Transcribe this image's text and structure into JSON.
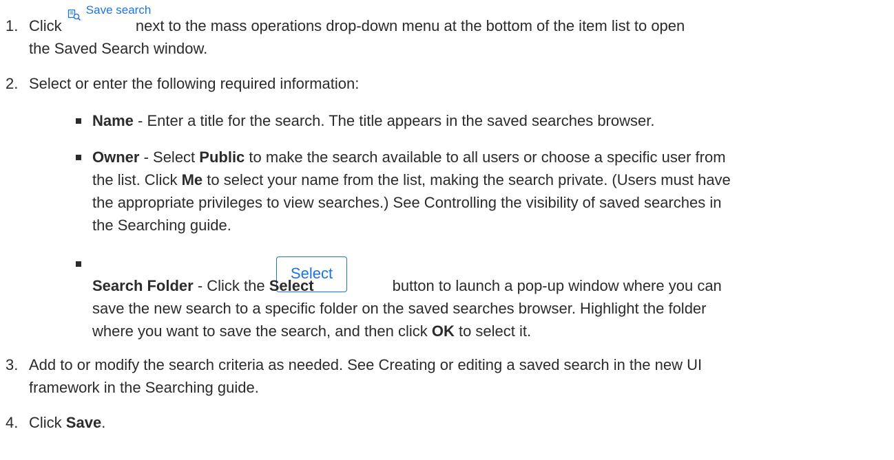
{
  "steps": [
    {
      "number": "1.",
      "pre": "Click",
      "button_label": "Save search",
      "button_icon": "save-search-icon",
      "post": "next to the mass operations drop-down menu at the bottom of the item list to open",
      "line2": "the Saved Search window."
    },
    {
      "number": "2.",
      "text": "Select or enter the following required information:"
    },
    {
      "number": "3.",
      "line1": "Add to or modify the search criteria as needed. See Creating or editing a saved search in the new UI",
      "line2": "framework in the Searching guide."
    },
    {
      "number": "4.",
      "pre": "Click",
      "bold": "Save",
      "post": "."
    }
  ],
  "bullets": {
    "name": {
      "term": "Name",
      "text": " - Enter a title for the search. The title appears in the saved searches browser."
    },
    "owner": {
      "term": "Owner",
      "t1": " - Select ",
      "b1": "Public",
      "t2": " to make the search available to all users or choose a specific user from",
      "t3": "the list. Click ",
      "b2": "Me",
      "t4": " to select your name from the list, making the search private. (Users must have",
      "line3": "the appropriate privileges to view searches.) See Controlling the visibility of saved searches in",
      "line4": "the Searching guide."
    },
    "folder": {
      "term": "Search Folder",
      "t1": " - Click the ",
      "b1": "Select",
      "t2": "button to launch a pop-up window where you can",
      "line2": "save the new search to a specific folder on the saved searches browser. Highlight the folder",
      "t3": "where you want to save the search, and then click ",
      "b2": "OK",
      "t4": " to select it.",
      "button_label": "Select"
    }
  },
  "colors": {
    "text": "#2b2b2b",
    "accent": "#1a73e8"
  }
}
